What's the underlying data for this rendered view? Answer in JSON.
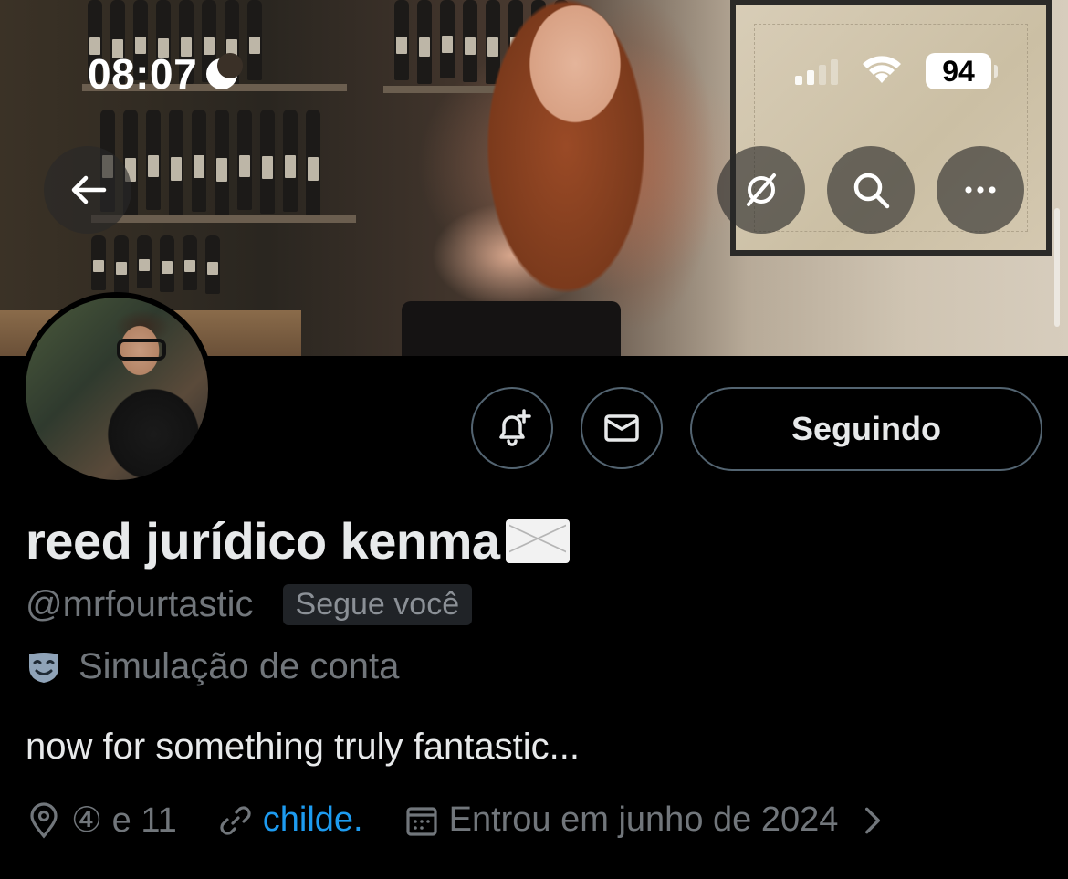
{
  "status_bar": {
    "time": "08:07",
    "battery": "94"
  },
  "header": {
    "back_icon": "arrow-left-icon",
    "grok_icon": "grok-icon",
    "search_icon": "search-icon",
    "more_icon": "more-horizontal-icon"
  },
  "profile": {
    "display_name": "reed jurídico kenma",
    "name_emoji": "envelope-emoji",
    "handle": "@mrfourtastic",
    "follows_you": "Segue você",
    "parody_label": "Simulação de conta",
    "bio": "now for something truly fantastic...",
    "location": "④ e 11",
    "link": "childe.",
    "joined": "Entrou em junho de 2024"
  },
  "actions": {
    "notify_icon": "bell-plus-icon",
    "message_icon": "mail-icon",
    "following_label": "Seguindo"
  },
  "colors": {
    "background": "#000000",
    "text_primary": "#e7e9ea",
    "text_secondary": "#71767b",
    "link": "#1d9bf0",
    "border": "#536471"
  }
}
